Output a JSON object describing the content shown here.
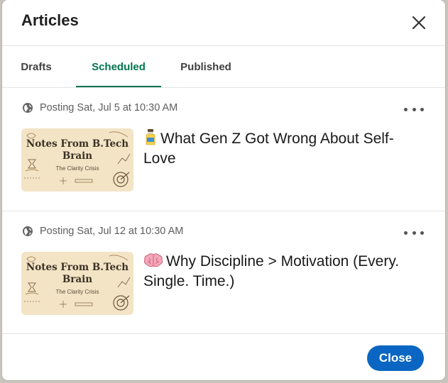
{
  "dialog": {
    "title": "Articles",
    "close_label": "Close"
  },
  "tabs": [
    {
      "label": "Drafts",
      "active": false
    },
    {
      "label": "Scheduled",
      "active": true
    },
    {
      "label": "Published",
      "active": false
    }
  ],
  "articles": [
    {
      "schedule": "Posting Sat, Jul 5 at 10:30 AM",
      "emoji_icon": "bottle-icon",
      "title": "What Gen Z Got Wrong About Self-Love",
      "thumbnail": {
        "heading": "Notes From B.Tech Brain",
        "subtitle": "The Clarity Crisis"
      }
    },
    {
      "schedule": "Posting Sat, Jul 12 at 10:30 AM",
      "emoji_icon": "brain-icon",
      "title": "Why Discipline > Motivation (Every. Single. Time.)",
      "thumbnail": {
        "heading": "Notes From B.Tech Brain",
        "subtitle": "The Clarity Crisis"
      }
    }
  ],
  "colors": {
    "active_tab": "#01754f",
    "primary_button": "#0a66c2",
    "thumbnail_bg": "#f3e4c6"
  }
}
